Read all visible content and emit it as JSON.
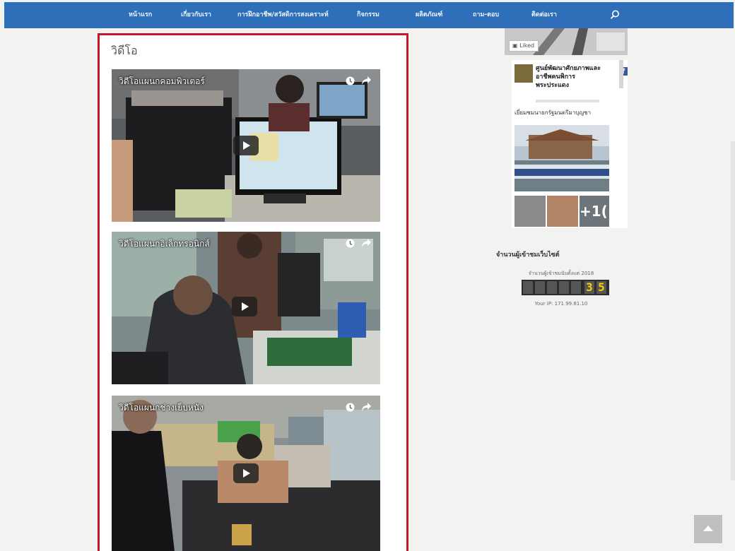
{
  "nav": {
    "items": [
      "หน้าแรก",
      "เกี่ยวกับเรา",
      "การฝึกอาชีพ/สวัสดิการสงเคราะห์",
      "กิจกรรม",
      "ผลิตภัณฑ์",
      "ถาม-ตอบ",
      "ติดต่อเรา"
    ],
    "search_icon": "search-icon",
    "bar_color": "#2f6fba"
  },
  "main": {
    "title": "วิดีโอ",
    "border_color": "#c8152a",
    "videos": [
      {
        "title": "วิดีโอแผนกคอมพิวเตอร์"
      },
      {
        "title": "วิดีโอแผนกอิเล็กทรอนิกส์"
      },
      {
        "title": "วิดีโอแผนกช่างเย็บหนัง"
      }
    ]
  },
  "sidebar": {
    "facebook": {
      "liked_label": "Liked",
      "page_name": "ศูนย์พัฒนาศักยภาพและอาชีพคนพิการ พระประแดง",
      "post_text": "เยี่ยมชมนายกรัฐมนตรีมาบุญชา",
      "more_photos": "+1("
    },
    "counter": {
      "title": "จำนวนผู้เข้าชมเว็บไซต์",
      "subtitle": "จำนวนผู้เข้าชมนับตั้งแต่ 2018",
      "digits": [
        "",
        "",
        "",
        "",
        "",
        "3",
        "5"
      ],
      "ip_text": "Your IP: 171.99.81.10"
    }
  }
}
